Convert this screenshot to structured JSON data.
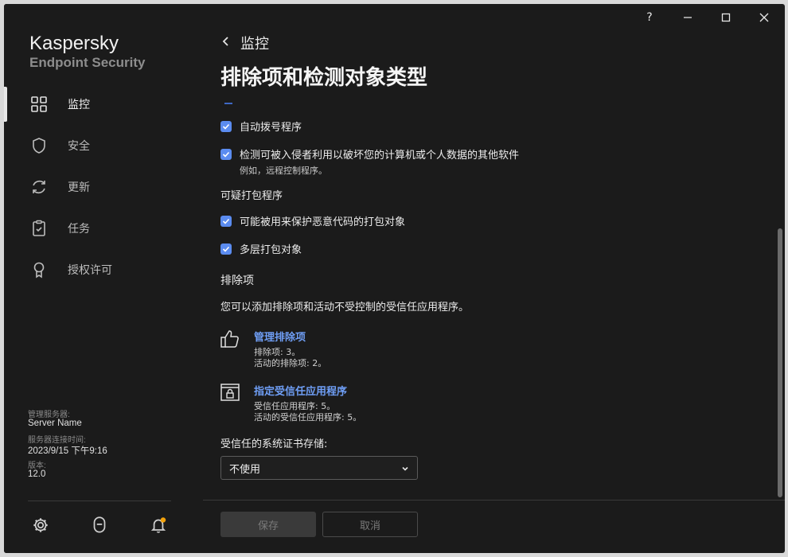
{
  "app": {
    "brand_line1": "Kaspersky",
    "brand_line2": "Endpoint Security"
  },
  "titlebar": {
    "help": "?",
    "minimize": "—",
    "maximize": "☐",
    "close": "✕"
  },
  "sidebar": {
    "items": [
      {
        "label": "监控",
        "icon": "dashboard-icon",
        "active": true
      },
      {
        "label": "安全",
        "icon": "shield-icon",
        "active": false
      },
      {
        "label": "更新",
        "icon": "refresh-icon",
        "active": false
      },
      {
        "label": "任务",
        "icon": "clipboard-icon",
        "active": false
      },
      {
        "label": "授权许可",
        "icon": "license-icon",
        "active": false
      }
    ],
    "info": {
      "server_label": "管理服务器:",
      "server_value": "Server Name",
      "conn_label": "服务器连接时间:",
      "conn_value": "2023/9/15 下午9:16",
      "version_label": "版本:",
      "version_value": "12.0"
    }
  },
  "header": {
    "breadcrumb": "监控",
    "title": "排除项和检测对象类型"
  },
  "content": {
    "checkboxes1": [
      {
        "label": "自动拨号程序",
        "checked": true
      },
      {
        "label": "检测可被入侵者利用以破坏您的计算机或个人数据的其他软件",
        "checked": true,
        "note": "例如，远程控制程序。"
      }
    ],
    "packers_title": "可疑打包程序",
    "checkboxes2": [
      {
        "label": "可能被用来保护恶意代码的打包对象",
        "checked": true
      },
      {
        "label": "多层打包对象",
        "checked": true
      }
    ],
    "exclusions_title": "排除项",
    "exclusions_desc": "您可以添加排除项和活动不受控制的受信任应用程序。",
    "links": [
      {
        "label": "管理排除项",
        "icon": "thumbs-up-icon",
        "notes": [
          "排除项: 3。",
          "活动的排除项: 2。"
        ]
      },
      {
        "label": "指定受信任应用程序",
        "icon": "app-lock-icon",
        "notes": [
          "受信任应用程序: 5。",
          "活动的受信任应用程序: 5。"
        ]
      }
    ],
    "cert_label": "受信任的系统证书存储:",
    "cert_value": "不使用"
  },
  "buttons": {
    "save": "保存",
    "cancel": "取消"
  },
  "colors": {
    "accent": "#5b8cf0",
    "link": "#6f9ef5",
    "background": "#1b1b1b"
  }
}
